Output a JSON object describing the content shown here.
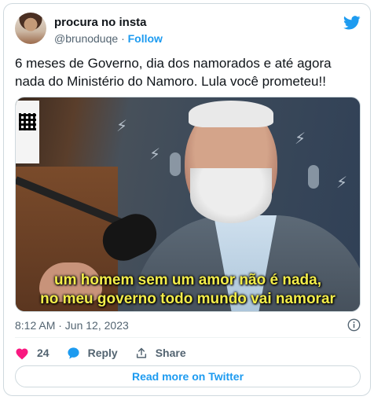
{
  "tweet": {
    "display_name": "procura no insta",
    "handle": "@brunoduqe",
    "separator": "·",
    "follow_label": "Follow",
    "text": "6 meses de Governo, dia dos namorados e até agora nada do Ministério do Namoro. Lula você prometeu!!",
    "timestamp": "8:12 AM · Jun 12, 2023",
    "likes_count": "24",
    "reply_label": "Reply",
    "share_label": "Share",
    "read_more_label": "Read more on Twitter"
  },
  "media": {
    "caption_line1": "um homem sem um amor não é nada,",
    "caption_line2": "no meu governo todo mundo vai namorar"
  },
  "icons": {
    "brand": "twitter-bird-icon",
    "info": "info-icon",
    "like": "heart-icon",
    "reply": "speech-bubble-icon",
    "share": "share-icon"
  },
  "colors": {
    "accent": "#1d9bf0",
    "like": "#f91880",
    "text": "#0f1419",
    "muted": "#536471",
    "caption": "#f4ee4a"
  }
}
